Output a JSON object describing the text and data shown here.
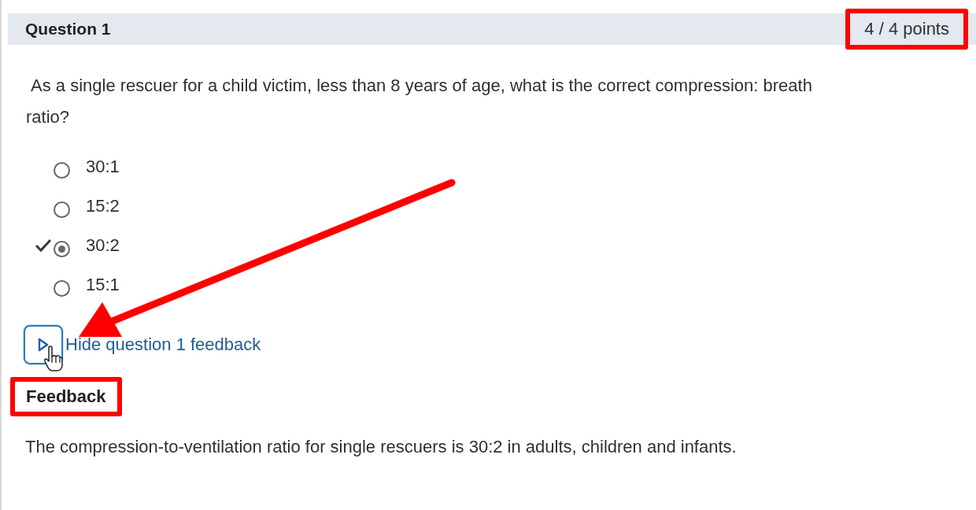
{
  "question": {
    "title": "Question 1",
    "score": "4 / 4 points",
    "score_highlighted": true,
    "text": "As a single rescuer for a child victim, less than 8 years of age, what is the correct compression: breath ratio?",
    "options": [
      {
        "label": "30:1",
        "selected": false,
        "correct": false
      },
      {
        "label": "15:2",
        "selected": false,
        "correct": false
      },
      {
        "label": "30:2",
        "selected": true,
        "correct": true
      },
      {
        "label": "15:1",
        "selected": false,
        "correct": false
      }
    ]
  },
  "feedback_toggle": {
    "label": "Hide question 1 feedback",
    "expanded": true,
    "hovered": true,
    "arrow_pointing": true
  },
  "feedback": {
    "heading": "Feedback",
    "heading_highlighted": true,
    "text": "The compression-to-ventilation ratio for single rescuers is 30:2 in adults, children and infants."
  }
}
